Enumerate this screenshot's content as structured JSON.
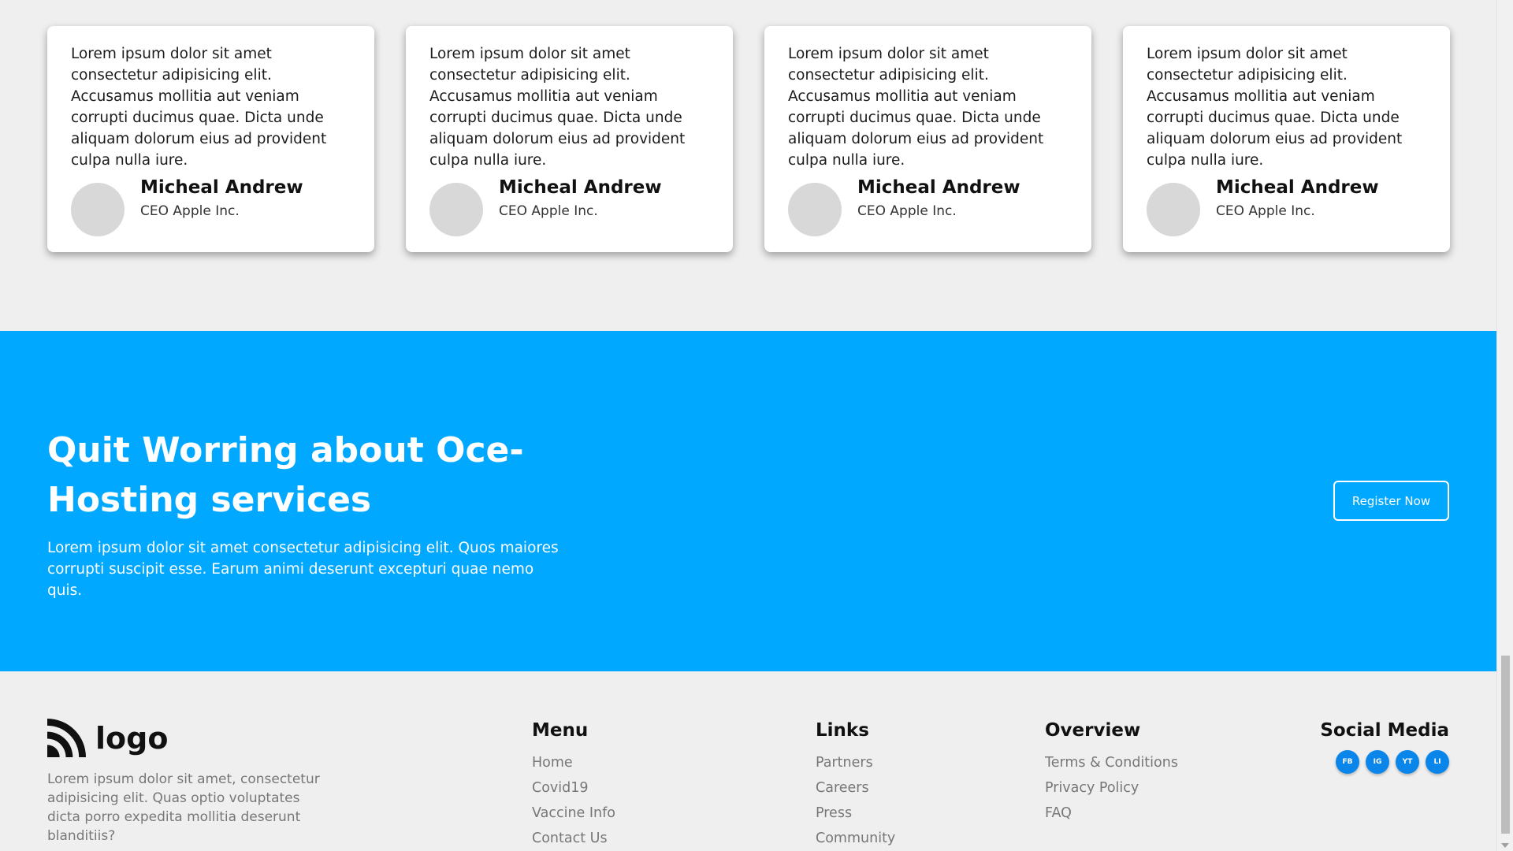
{
  "testimonials": [
    {
      "text": "Lorem ipsum dolor sit amet consectetur adipisicing elit. Accusamus mollitia aut veniam corrupti ducimus quae. Dicta unde aliquam dolorum eius ad provident culpa nulla iure.",
      "name": "Micheal Andrew",
      "role": "CEO Apple Inc."
    },
    {
      "text": "Lorem ipsum dolor sit amet consectetur adipisicing elit. Accusamus mollitia aut veniam corrupti ducimus quae. Dicta unde aliquam dolorum eius ad provident culpa nulla iure.",
      "name": "Micheal Andrew",
      "role": "CEO Apple Inc."
    },
    {
      "text": "Lorem ipsum dolor sit amet consectetur adipisicing elit. Accusamus mollitia aut veniam corrupti ducimus quae. Dicta unde aliquam dolorum eius ad provident culpa nulla iure.",
      "name": "Micheal Andrew",
      "role": "CEO Apple Inc."
    },
    {
      "text": "Lorem ipsum dolor sit amet consectetur adipisicing elit. Accusamus mollitia aut veniam corrupti ducimus quae. Dicta unde aliquam dolorum eius ad provident culpa nulla iure.",
      "name": "Micheal Andrew",
      "role": "CEO Apple Inc."
    }
  ],
  "cta": {
    "title": "Quit Worring about Oce-Hosting services",
    "text": "Lorem ipsum dolor sit amet consectetur adipisicing elit. Quos maiores corrupti suscipit esse. Earum animi deserunt excepturi quae nemo quis.",
    "button_label": "Register Now",
    "background_color": "#00a8ff"
  },
  "footer": {
    "logo_text": "logo",
    "logo_icon": "rss-icon",
    "description": "Lorem ipsum dolor sit amet, consectetur adipisicing elit. Quas optio voluptates dicta porro expedita mollitia deserunt blanditiis?",
    "menu": {
      "title": "Menu",
      "items": [
        "Home",
        "Covid19",
        "Vaccine Info",
        "Contact Us"
      ]
    },
    "links": {
      "title": "Links",
      "items": [
        "Partners",
        "Careers",
        "Press",
        "Community"
      ]
    },
    "overview": {
      "title": "Overview",
      "items": [
        "Terms & Conditions",
        "Privacy Policy",
        "FAQ"
      ]
    },
    "social": {
      "title": "Social Media",
      "items": [
        "FB",
        "IG",
        "YT",
        "LI"
      ],
      "icon_color": "#0a86ea"
    }
  }
}
